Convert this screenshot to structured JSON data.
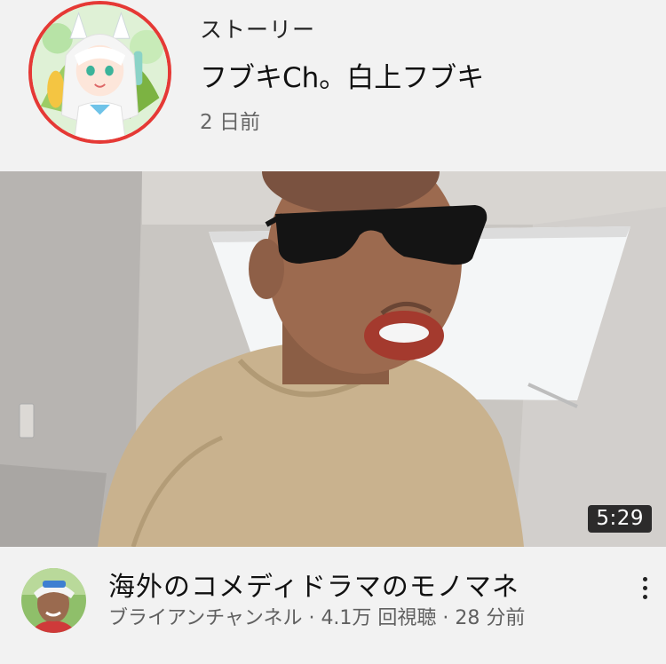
{
  "story": {
    "label": "ストーリー",
    "channel": "フブキCh。白上フブキ",
    "age": "2 日前"
  },
  "video": {
    "duration": "5:29",
    "title": "海外のコメディドラマのモノマネ",
    "channel": "ブライアンチャンネル",
    "views": "4.1万 回視聴",
    "uploaded": "28 分前",
    "subtitle": "ブライアンチャンネル · 4.1万 回視聴 · 28 分前"
  },
  "colors": {
    "story_ring": "#e53935",
    "background": "#f2f2f2",
    "duration_badge": "#141414"
  },
  "icons": {
    "more": "vertical-ellipsis"
  }
}
